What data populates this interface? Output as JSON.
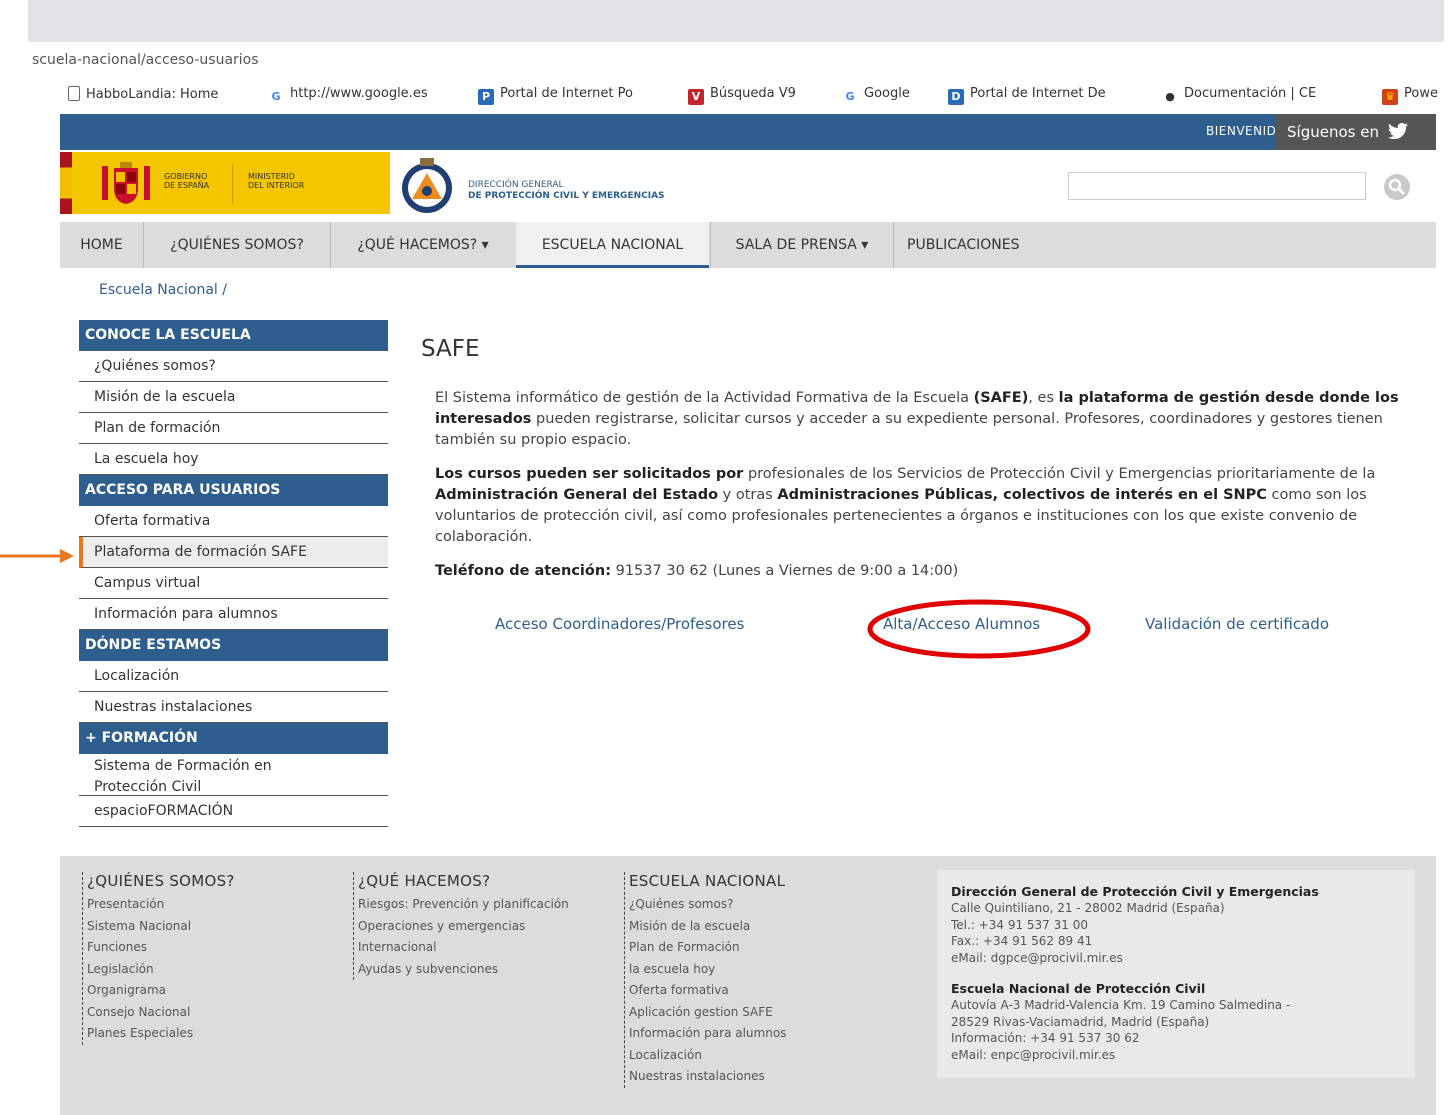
{
  "browser": {
    "url": "scuela-nacional/acceso-usuarios",
    "bookmarks": [
      {
        "label": "HabboLandia: Home",
        "icon": "page-icon"
      },
      {
        "label": "http://www.google.es",
        "icon": "google-icon"
      },
      {
        "label": "Portal de Internet Po",
        "icon": "p-icon"
      },
      {
        "label": "Búsqueda V9",
        "icon": "v9-icon"
      },
      {
        "label": "Google",
        "icon": "google-icon"
      },
      {
        "label": "Portal de Internet De",
        "icon": "d-icon"
      },
      {
        "label": "Documentación | CE",
        "icon": "doc-icon"
      },
      {
        "label": "Powe",
        "icon": "power-icon"
      }
    ]
  },
  "header": {
    "bienvenido": "BIENVENIDO",
    "siguenos": "Síguenos en",
    "gov_line1": "GOBIERNO",
    "gov_line2": "DE ESPAÑA",
    "min_line1": "MINISTERIO",
    "min_line2": "DEL INTERIOR",
    "dg_line1": "DIRECCIÓN GENERAL",
    "dg_line2": "DE PROTECCIÓN CIVIL Y EMERGENCIAS",
    "search_placeholder": ""
  },
  "menu": {
    "items": [
      "HOME",
      "¿QUIÉNES SOMOS?",
      "¿QUÉ HACEMOS? ▾",
      "ESCUELA NACIONAL",
      "SALA DE PRENSA ▾",
      "PUBLICACIONES"
    ]
  },
  "breadcrumb": "Escuela Nacional /",
  "sidebar": {
    "sections": [
      {
        "title": "CONOCE LA ESCUELA",
        "items": [
          "¿Quiénes somos?",
          "Misión de la escuela",
          "Plan de formación",
          "La escuela hoy"
        ]
      },
      {
        "title": "ACCESO PARA USUARIOS",
        "items": [
          "Oferta formativa",
          "Plataforma de formación SAFE",
          "Campus virtual",
          "Información para alumnos"
        ]
      },
      {
        "title": "DÓNDE ESTAMOS",
        "items": [
          "Localización",
          "Nuestras instalaciones"
        ]
      },
      {
        "title": "+ FORMACIÓN",
        "items": [
          "Sistema de Formación en Protección Civil",
          "espacioFORMACIÓN"
        ]
      }
    ]
  },
  "main": {
    "title": "SAFE",
    "p1": {
      "a": "El Sistema informático de gestión de la Actividad Formativa de la Escuela ",
      "b": "(SAFE)",
      "c": ", es ",
      "d": "la plataforma de gestión desde donde los interesados",
      "e": " pueden registrarse, solicitar cursos y acceder a su expediente personal. Profesores, coordinadores y gestores tienen también su propio espacio."
    },
    "p2": {
      "a": "Los cursos pueden ser solicitados por",
      "b": " profesionales de los Servicios de Protección Civil y Emergencias prioritariamente de la ",
      "c": "Administración General del Estado",
      "d": " y otras ",
      "e": "Administraciones Públicas, colectivos de interés en el SNPC",
      "f": " como son los voluntarios de protección civil, así como profesionales pertenecientes a órganos e instituciones con los que existe convenio de colaboración."
    },
    "phone_label": "Teléfono de atención:",
    "phone_value": " 91537 30 62 (Lunes a Viernes de 9:00 a 14:00)",
    "links": [
      "Acceso Coordinadores/Profesores",
      "Alta/Acceso Alumnos",
      "Validación de certificado"
    ]
  },
  "footer": {
    "cols": [
      {
        "title": "¿QUIÉNES SOMOS?",
        "items": [
          "Presentación",
          "Sistema Nacional",
          "Funciones",
          "Legislación",
          "Organigrama",
          "Consejo Nacional",
          "Planes Especiales"
        ]
      },
      {
        "title": "¿QUÉ HACEMOS?",
        "items": [
          "Riesgos: Prevención y planificación",
          "Operaciones y emergencias",
          "Internacional",
          "Ayudas y subvenciones"
        ]
      },
      {
        "title": "ESCUELA NACIONAL",
        "items": [
          "¿Quiénes somos?",
          "Misión de la escuela",
          "Plan de Formación",
          "la escuela hoy",
          "Oferta formativa",
          "Aplicación gestion SAFE",
          "Información para alumnos",
          "Localización",
          "Nuestras instalaciones"
        ]
      }
    ],
    "contact1": {
      "title": "Dirección General de Protección Civil y Emergencias",
      "lines": [
        "Calle Quintiliano, 21 - 28002 Madrid (España)",
        "Tel.: +34 91 537 31 00",
        "Fax.: +34 91 562 89 41",
        "eMail: dgpce@procivil.mir.es"
      ]
    },
    "contact2": {
      "title": "Escuela Nacional de Protección Civil",
      "lines": [
        "Autovía A-3 Madrid-Valencia Km. 19 Camino Salmedina -",
        "28529 Rivas-Vaciamadrid, Madrid (España)",
        "Información: +34 91 537 30 62",
        "eMail: enpc@procivil.mir.es"
      ]
    }
  },
  "colors": {
    "brand_blue": "#2d5e8e",
    "gov_yellow": "#f4c600",
    "arrow_orange": "#e87722",
    "circle_red": "#e00000"
  }
}
